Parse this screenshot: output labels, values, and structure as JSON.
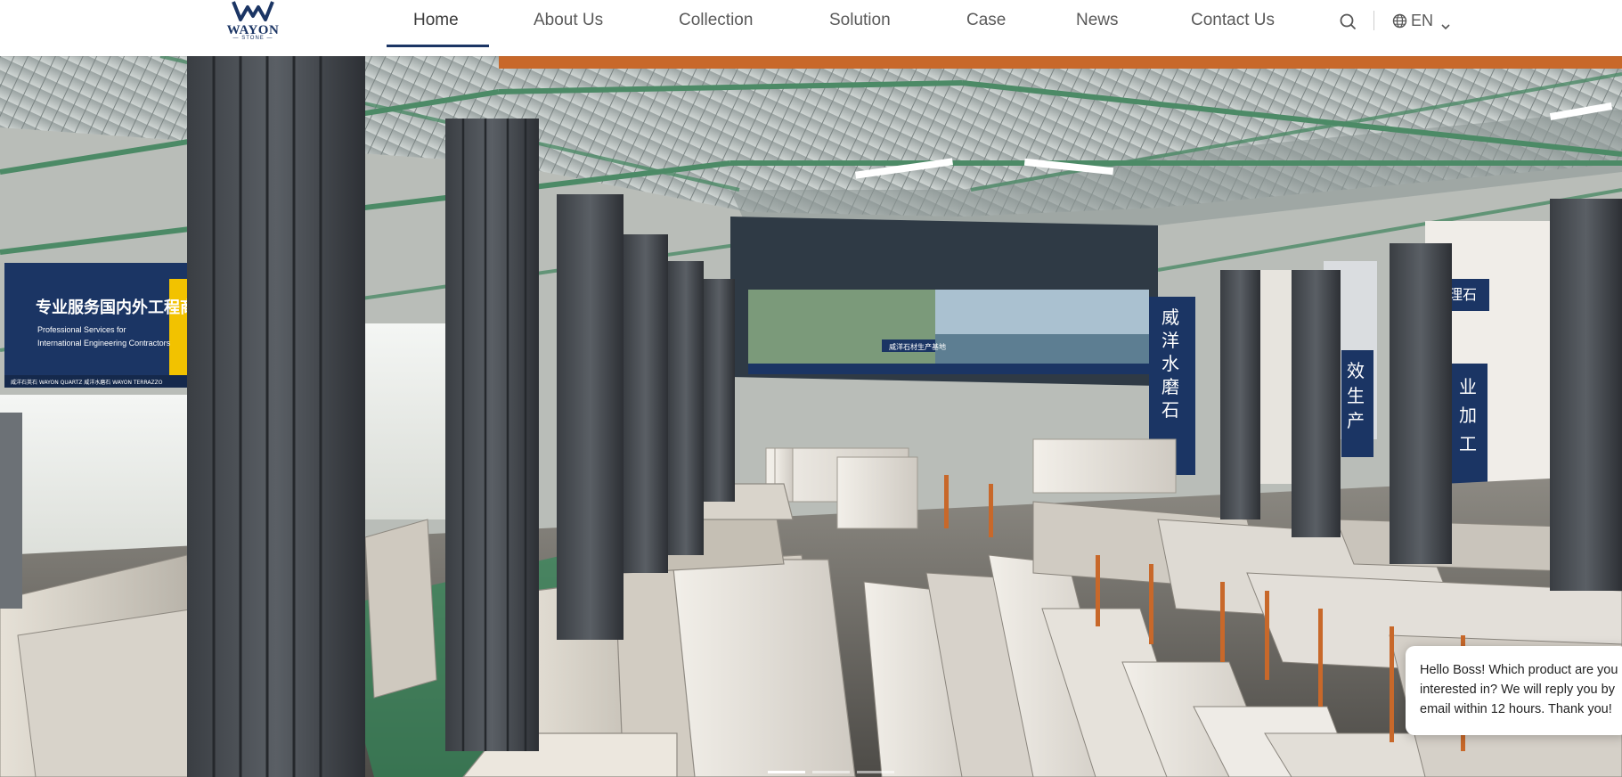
{
  "brand": {
    "name": "WAYON",
    "sub": "— STONE —",
    "primary_color": "#1b3564",
    "accent_color": "#c8682a"
  },
  "nav": {
    "items": [
      {
        "label": "Home",
        "active": true
      },
      {
        "label": "About Us",
        "active": false
      },
      {
        "label": "Collection",
        "active": false
      },
      {
        "label": "Solution",
        "active": false
      },
      {
        "label": "Case",
        "active": false
      },
      {
        "label": "News",
        "active": false
      },
      {
        "label": "Contact Us",
        "active": false
      }
    ],
    "search_icon": "search-icon",
    "language": {
      "label": "EN",
      "icon": "globe-icon",
      "dropdown_icon": "chevron-down-icon"
    }
  },
  "hero": {
    "banner_left": {
      "title_cn": "专业服务国内外工程商",
      "line1": "Professional Services for",
      "line2": "International Engineering Contractors",
      "footer": "威洋石英石  WAYON QUARTZ   威洋水磨石  WAYON TERRAZZO"
    },
    "banner_center_cn": "威洋石材生产基地",
    "banner_right_cn": [
      "威",
      "洋",
      "水",
      "磨",
      "石"
    ],
    "banner_right2_cn": [
      "效",
      "生",
      "产"
    ],
    "banner_right3_cn": [
      "业",
      "加",
      "工"
    ],
    "banner_right4_cn": "大理石",
    "slide_count": 3,
    "active_slide": 1
  },
  "chat": {
    "message": "Hello Boss! Which product are you interested in? We will reply you by email within 12 hours. Thank you!"
  }
}
